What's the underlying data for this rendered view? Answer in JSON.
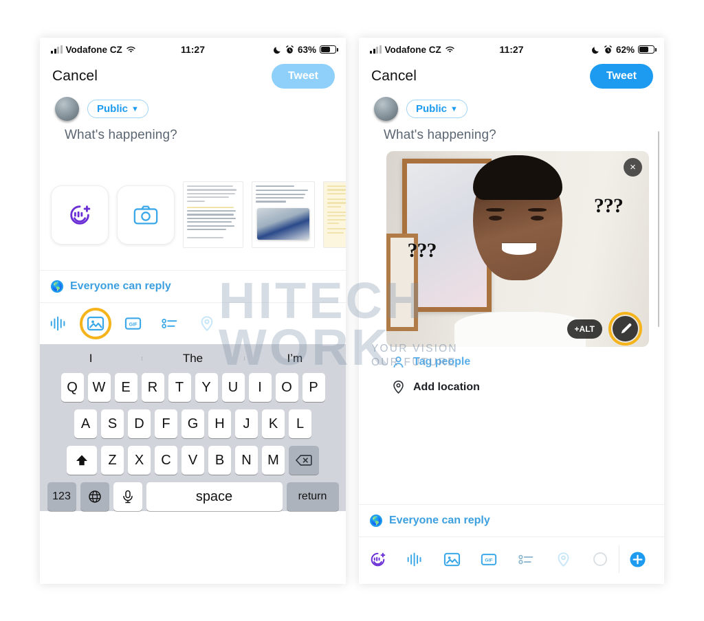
{
  "watermark": {
    "line1": "HITECH",
    "line2": "WORK",
    "tagline1": "YOUR VISION",
    "tagline2": "OUR FUTURE"
  },
  "phone_left": {
    "status": {
      "carrier": "Vodafone CZ",
      "time": "11:27",
      "battery": "63%",
      "moon_icon": "crescent-moon-icon",
      "alarm_icon": "alarm-clock-icon",
      "wifi_icon": "wifi-icon",
      "signal_icon": "signal-bars-icon"
    },
    "nav": {
      "cancel": "Cancel",
      "tweet": "Tweet",
      "tweet_enabled": false
    },
    "composer": {
      "audience": "Public",
      "placeholder": "What's happening?",
      "text": ""
    },
    "media_tiles": [
      {
        "name": "sticker-button",
        "icon": "smiley-plus-icon"
      },
      {
        "name": "camera-button",
        "icon": "camera-icon"
      }
    ],
    "gallery": [
      {
        "name": "gallery-thumb-1",
        "kind": "article-screenshot"
      },
      {
        "name": "gallery-thumb-2",
        "kind": "article-screenshot-with-photo"
      },
      {
        "name": "gallery-thumb-3",
        "kind": "article-screenshot-yellow"
      }
    ],
    "reply": {
      "label": "Everyone can reply",
      "icon": "globe-icon"
    },
    "toolbar": [
      {
        "name": "audio-button",
        "icon": "audio-waveform-icon",
        "highlighted": false,
        "dimmed": false
      },
      {
        "name": "image-button",
        "icon": "image-icon",
        "highlighted": true,
        "dimmed": false
      },
      {
        "name": "gif-button",
        "icon": "gif-icon",
        "label": "GIF",
        "highlighted": false,
        "dimmed": false
      },
      {
        "name": "poll-button",
        "icon": "poll-list-icon",
        "highlighted": false,
        "dimmed": false
      },
      {
        "name": "location-button",
        "icon": "location-pin-icon",
        "highlighted": false,
        "dimmed": true
      }
    ],
    "keyboard": {
      "predictions": [
        "I",
        "The",
        "I’m"
      ],
      "row1": [
        "Q",
        "W",
        "E",
        "R",
        "T",
        "Y",
        "U",
        "I",
        "O",
        "P"
      ],
      "row2": [
        "A",
        "S",
        "D",
        "F",
        "G",
        "H",
        "J",
        "K",
        "L"
      ],
      "row3": [
        "Z",
        "X",
        "C",
        "V",
        "B",
        "N",
        "M"
      ],
      "shift_icon": "shift-arrow-icon",
      "backspace_icon": "backspace-icon",
      "numbers_key": "123",
      "globe_key_icon": "globe-keyboard-icon",
      "mic_key_icon": "microphone-icon",
      "space_key": "space",
      "return_key": "return"
    }
  },
  "phone_right": {
    "status": {
      "carrier": "Vodafone CZ",
      "time": "11:27",
      "battery": "62%",
      "moon_icon": "crescent-moon-icon",
      "alarm_icon": "alarm-clock-icon",
      "wifi_icon": "wifi-icon",
      "signal_icon": "signal-bars-icon"
    },
    "nav": {
      "cancel": "Cancel",
      "tweet": "Tweet",
      "tweet_enabled": true
    },
    "composer": {
      "audience": "Public",
      "placeholder": "What's happening?",
      "text": ""
    },
    "attachment": {
      "name": "attached-image",
      "description": "confused-man-meme",
      "overlay_text_1": "???",
      "overlay_text_2": "???",
      "close_label": "×",
      "alt_label": "+ALT",
      "edit_icon": "brush-edit-icon",
      "edit_highlighted": true
    },
    "meta": [
      {
        "name": "tag-people-button",
        "label": "Tag people",
        "icon": "person-icon",
        "style": "blue"
      },
      {
        "name": "add-location-button",
        "label": "Add location",
        "icon": "location-pin-icon",
        "style": "dark"
      }
    ],
    "reply": {
      "label": "Everyone can reply",
      "icon": "globe-icon"
    },
    "toolbar": [
      {
        "name": "sticker-button",
        "icon": "smiley-plus-icon",
        "dimmed": false
      },
      {
        "name": "audio-button",
        "icon": "audio-waveform-icon",
        "dimmed": false
      },
      {
        "name": "image-button",
        "icon": "image-icon",
        "dimmed": false
      },
      {
        "name": "gif-button",
        "icon": "gif-icon",
        "label": "GIF",
        "dimmed": false
      },
      {
        "name": "poll-button",
        "icon": "poll-list-icon",
        "dimmed": false
      },
      {
        "name": "location-button",
        "icon": "location-pin-icon",
        "dimmed": true
      },
      {
        "name": "character-count-ring",
        "icon": "progress-circle-icon",
        "dimmed": false
      },
      {
        "name": "add-tweet-button",
        "icon": "plus-circle-icon",
        "dimmed": false
      }
    ]
  },
  "colors": {
    "twitter_blue": "#1d9bf0",
    "tweet_disabled": "#8ed0f9",
    "highlight_orange": "#f5b31c",
    "purple": "#6b2fd6",
    "text_dark": "#1c2024",
    "placeholder_gray": "#5b6672"
  }
}
